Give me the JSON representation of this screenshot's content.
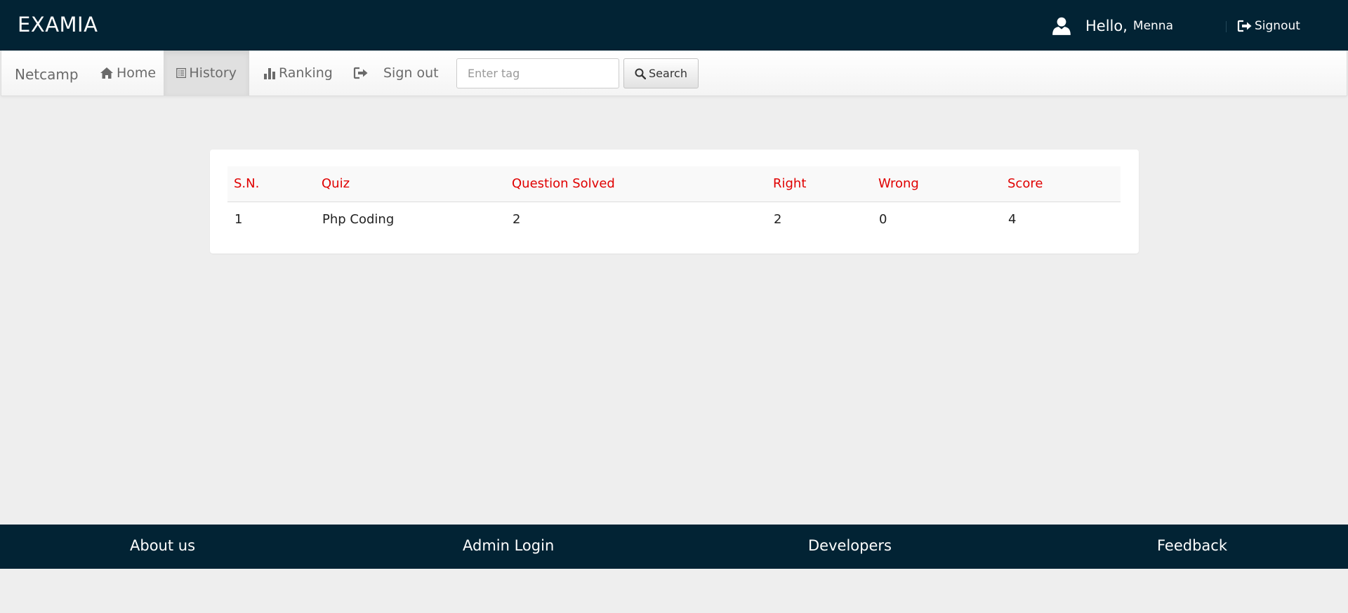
{
  "header": {
    "brand": "EXAMIA",
    "hello": "Hello,",
    "username": "Menna",
    "signout_label": "Signout"
  },
  "navbar": {
    "brand": "Netcamp",
    "items": [
      {
        "label": "Home",
        "icon": "home-icon"
      },
      {
        "label": "History",
        "icon": "list-icon",
        "active": true
      },
      {
        "label": "Ranking",
        "icon": "bar-chart-icon"
      },
      {
        "label": "Sign out",
        "icon": "log-out-icon"
      }
    ],
    "search": {
      "placeholder": "Enter tag",
      "value": "",
      "button_label": "Search"
    }
  },
  "history_table": {
    "columns": [
      "S.N.",
      "Quiz",
      "Question Solved",
      "Right",
      "Wrong",
      "Score"
    ],
    "rows": [
      [
        "1",
        "Php Coding",
        "2",
        "2",
        "0",
        "4"
      ]
    ]
  },
  "footer": {
    "links": [
      "About us",
      "Admin Login",
      "Developers",
      "Feedback"
    ]
  },
  "colors": {
    "header_bg": "#022334",
    "column_header": "#e00000",
    "page_bg": "#eeeeee"
  }
}
